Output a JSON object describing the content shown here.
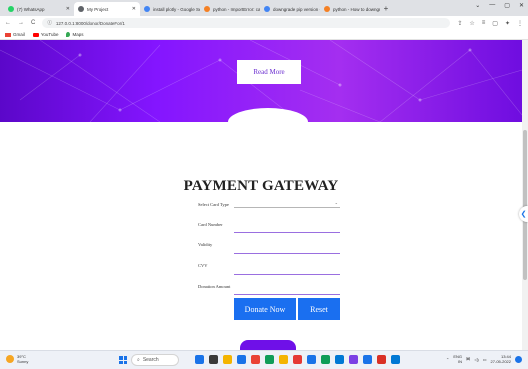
{
  "browser": {
    "tabs": [
      {
        "label": "(7) WhatsApp",
        "color": "#25d366",
        "active": false,
        "width": 70
      },
      {
        "label": "My Project",
        "color": "#5f6368",
        "active": true,
        "width": 66
      },
      {
        "label": "install plotly - Google Sear",
        "color": "#4285f4",
        "active": false,
        "width": 60
      },
      {
        "label": "python - ImportError: cann",
        "color": "#f48024",
        "active": false,
        "width": 60
      },
      {
        "label": "downgrade pip version - G",
        "color": "#4285f4",
        "active": false,
        "width": 60
      },
      {
        "label": "python - How to downgrad",
        "color": "#f48024",
        "active": false,
        "width": 60
      }
    ],
    "new_tab": "+",
    "window_controls": [
      "⌄",
      "—",
      "▢",
      "✕"
    ],
    "url": "127.0.0.1:8000/donor/DonateFor/1",
    "bookmarks": [
      {
        "label": "Gmail",
        "color": "#ea4335"
      },
      {
        "label": "YouTube",
        "color": "#ff0000"
      },
      {
        "label": "Maps",
        "color": "#34a853"
      }
    ]
  },
  "page": {
    "read_more": "Read More",
    "title": "PAYMENT GATEWAY",
    "fields": {
      "card_type": "Select Card Type",
      "card_number": "Card Number",
      "validity": "Validity",
      "cvv": "CVV",
      "amount": "Donation Amount"
    },
    "buttons": {
      "donate": "Donate Now",
      "reset": "Reset"
    }
  },
  "colors": {
    "accent": "#1a6ff0",
    "hero": "#8415ff",
    "underline": "#9a6fe0"
  },
  "taskbar": {
    "weather_temp": "39°C",
    "weather_desc": "Sunny",
    "search": "Search",
    "lang": "ENG",
    "lang_sub": "IN",
    "time": "13:44",
    "date": "27-05-2022",
    "app_colors": [
      "#1a73e8",
      "#3a3a3a",
      "#f4b400",
      "#1a73e8",
      "#ea4335",
      "#0f9d58",
      "#f4b400",
      "#e53935",
      "#1a73e8",
      "#0f9d58",
      "#0078d4",
      "#7b3fe4",
      "#1a73e8",
      "#d93025",
      "#0078d4"
    ]
  }
}
